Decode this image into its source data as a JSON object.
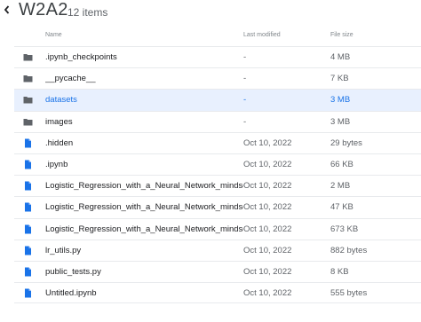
{
  "header": {
    "title": "W2A2",
    "item_count": "12 items"
  },
  "columns": {
    "name": "Name",
    "modified": "Last modified",
    "size": "File size"
  },
  "colors": {
    "folder_icon": "#5f6368",
    "file_icon": "#1a73e8",
    "selected_bg": "#e8f0fe",
    "selected_text": "#1a73e8"
  },
  "files": [
    {
      "name": ".ipynb_checkpoints",
      "modified": "-",
      "size": "4 MB",
      "type": "folder",
      "icon": "folder-icon",
      "selected": false
    },
    {
      "name": "__pycache__",
      "modified": "-",
      "size": "7 KB",
      "type": "folder",
      "icon": "folder-icon",
      "selected": false
    },
    {
      "name": "datasets",
      "modified": "-",
      "size": "3 MB",
      "type": "folder",
      "icon": "folder-icon",
      "selected": true
    },
    {
      "name": "images",
      "modified": "-",
      "size": "3 MB",
      "type": "folder",
      "icon": "folder-icon",
      "selected": false
    },
    {
      "name": ".hidden",
      "modified": "Oct 10, 2022",
      "size": "29 bytes",
      "type": "file",
      "icon": "file-icon",
      "selected": false
    },
    {
      "name": ".ipynb",
      "modified": "Oct 10, 2022",
      "size": "66 KB",
      "type": "file",
      "icon": "file-icon",
      "selected": false
    },
    {
      "name": "Logistic_Regression_with_a_Neural_Network_mindset-",
      "modified": "Oct 10, 2022",
      "size": "2 MB",
      "type": "file",
      "icon": "file-icon",
      "selected": false
    },
    {
      "name": "Logistic_Regression_with_a_Neural_Network_mindset.i",
      "modified": "Oct 10, 2022",
      "size": "47 KB",
      "type": "file",
      "icon": "file-icon",
      "selected": false
    },
    {
      "name": "Logistic_Regression_with_a_Neural_Network_mindset_",
      "modified": "Oct 10, 2022",
      "size": "673 KB",
      "type": "file",
      "icon": "file-icon",
      "selected": false
    },
    {
      "name": "lr_utils.py",
      "modified": "Oct 10, 2022",
      "size": "882 bytes",
      "type": "file",
      "icon": "file-icon",
      "selected": false
    },
    {
      "name": "public_tests.py",
      "modified": "Oct 10, 2022",
      "size": "8 KB",
      "type": "file",
      "icon": "file-icon",
      "selected": false
    },
    {
      "name": "Untitled.ipynb",
      "modified": "Oct 10, 2022",
      "size": "555 bytes",
      "type": "file",
      "icon": "file-icon",
      "selected": false
    }
  ]
}
